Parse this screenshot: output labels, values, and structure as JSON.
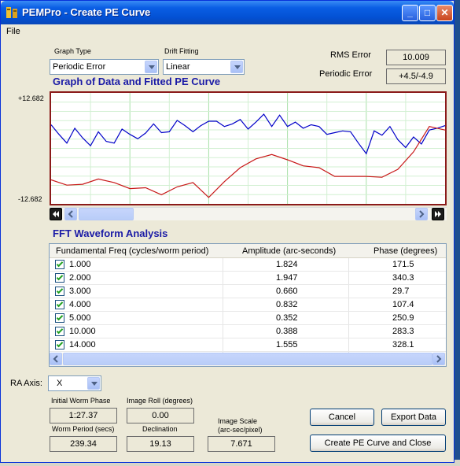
{
  "window": {
    "title": "PEMPro - Create PE Curve",
    "buttons": {
      "minimize": "_",
      "maximize": "□",
      "close": "✕"
    }
  },
  "menu": {
    "file": "File"
  },
  "graph_type": {
    "label": "Graph Type",
    "value": "Periodic Error"
  },
  "drift_fitting": {
    "label": "Drift Fitting",
    "value": "Linear"
  },
  "rms_error": {
    "label": "RMS Error",
    "value": "10.009"
  },
  "periodic_error": {
    "label": "Periodic Error",
    "value": "+4.5/-4.9"
  },
  "graph": {
    "title": "Graph of Data and Fitted PE Curve",
    "y_max_label": "+12.682",
    "y_min_label": "-12.682"
  },
  "chart_data": {
    "type": "line",
    "title": "Graph of Data and Fitted PE Curve",
    "ylim": [
      -12.682,
      12.682
    ],
    "xlim": [
      0,
      100
    ],
    "grid": true,
    "series": [
      {
        "color": "#0000c8",
        "x": [
          0,
          2,
          4,
          6,
          8,
          10,
          12,
          14,
          16,
          18,
          20,
          22,
          24,
          26,
          28,
          30,
          32,
          34,
          36,
          38,
          40,
          42,
          44,
          46,
          48,
          50,
          52,
          54,
          56,
          58,
          60,
          62,
          64,
          66,
          68,
          70,
          72,
          74,
          76,
          78,
          80,
          82,
          84,
          86,
          88,
          90,
          92,
          94,
          96,
          98,
          100
        ],
        "y": [
          5.4,
          3.2,
          1.2,
          4.6,
          2.4,
          0.6,
          3.8,
          1.6,
          1.2,
          4.4,
          3.2,
          2.2,
          3.5,
          5.6,
          3.6,
          3.8,
          6.4,
          5.2,
          3.8,
          5.2,
          6.2,
          6.2,
          5.0,
          5.6,
          6.6,
          4.4,
          6.0,
          7.8,
          5.0,
          7.6,
          5.0,
          6.0,
          4.6,
          5.4,
          5.0,
          3.2,
          3.6,
          4.0,
          3.8,
          1.2,
          -1.2,
          4.0,
          3.0,
          5.0,
          2.0,
          0.2,
          2.6,
          1.0,
          4.2,
          4.6,
          5.2
        ]
      },
      {
        "color": "#c81818",
        "x": [
          0,
          4,
          8,
          12,
          16,
          20,
          24,
          28,
          32,
          36,
          40,
          44,
          48,
          52,
          56,
          60,
          64,
          68,
          72,
          76,
          80,
          84,
          88,
          92,
          96,
          100
        ],
        "y": [
          -7.2,
          -8.4,
          -8.2,
          -7.0,
          -7.8,
          -9.2,
          -9.0,
          -10.6,
          -8.8,
          -7.8,
          -11.2,
          -7.6,
          -4.4,
          -2.4,
          -1.4,
          -2.6,
          -4.0,
          -4.4,
          -6.4,
          -6.4,
          -6.4,
          -6.6,
          -4.8,
          -0.8,
          5.0,
          4.2
        ]
      }
    ]
  },
  "fft": {
    "title": "FFT Waveform Analysis",
    "columns": [
      "Fundamental Freq (cycles/worm period)",
      "Amplitude (arc-seconds)",
      "Phase (degrees)"
    ],
    "rows": [
      {
        "freq": "1.000",
        "amplitude": "1.824",
        "phase": "171.5"
      },
      {
        "freq": "2.000",
        "amplitude": "1.947",
        "phase": "340.3"
      },
      {
        "freq": "3.000",
        "amplitude": "0.660",
        "phase": "29.7"
      },
      {
        "freq": "4.000",
        "amplitude": "0.832",
        "phase": "107.4"
      },
      {
        "freq": "5.000",
        "amplitude": "0.352",
        "phase": "250.9"
      },
      {
        "freq": "10.000",
        "amplitude": "0.388",
        "phase": "283.3"
      },
      {
        "freq": "14.000",
        "amplitude": "1.555",
        "phase": "328.1"
      }
    ]
  },
  "ra_axis": {
    "label": "RA Axis:",
    "value": "X"
  },
  "initial_worm_phase": {
    "label": "Initial Worm Phase",
    "value": "1:27.37"
  },
  "image_roll": {
    "label": "Image Roll (degrees)",
    "value": "0.00"
  },
  "worm_period": {
    "label": "Worm Period (secs)",
    "value": "239.34"
  },
  "declination": {
    "label": "Declination",
    "value": "19.13"
  },
  "image_scale": {
    "label_line1": "Image Scale",
    "label_line2": "(arc-sec/pixel)",
    "value": "7.671"
  },
  "buttons": {
    "cancel": "Cancel",
    "export": "Export Data",
    "create_close": "Create PE Curve and Close"
  }
}
